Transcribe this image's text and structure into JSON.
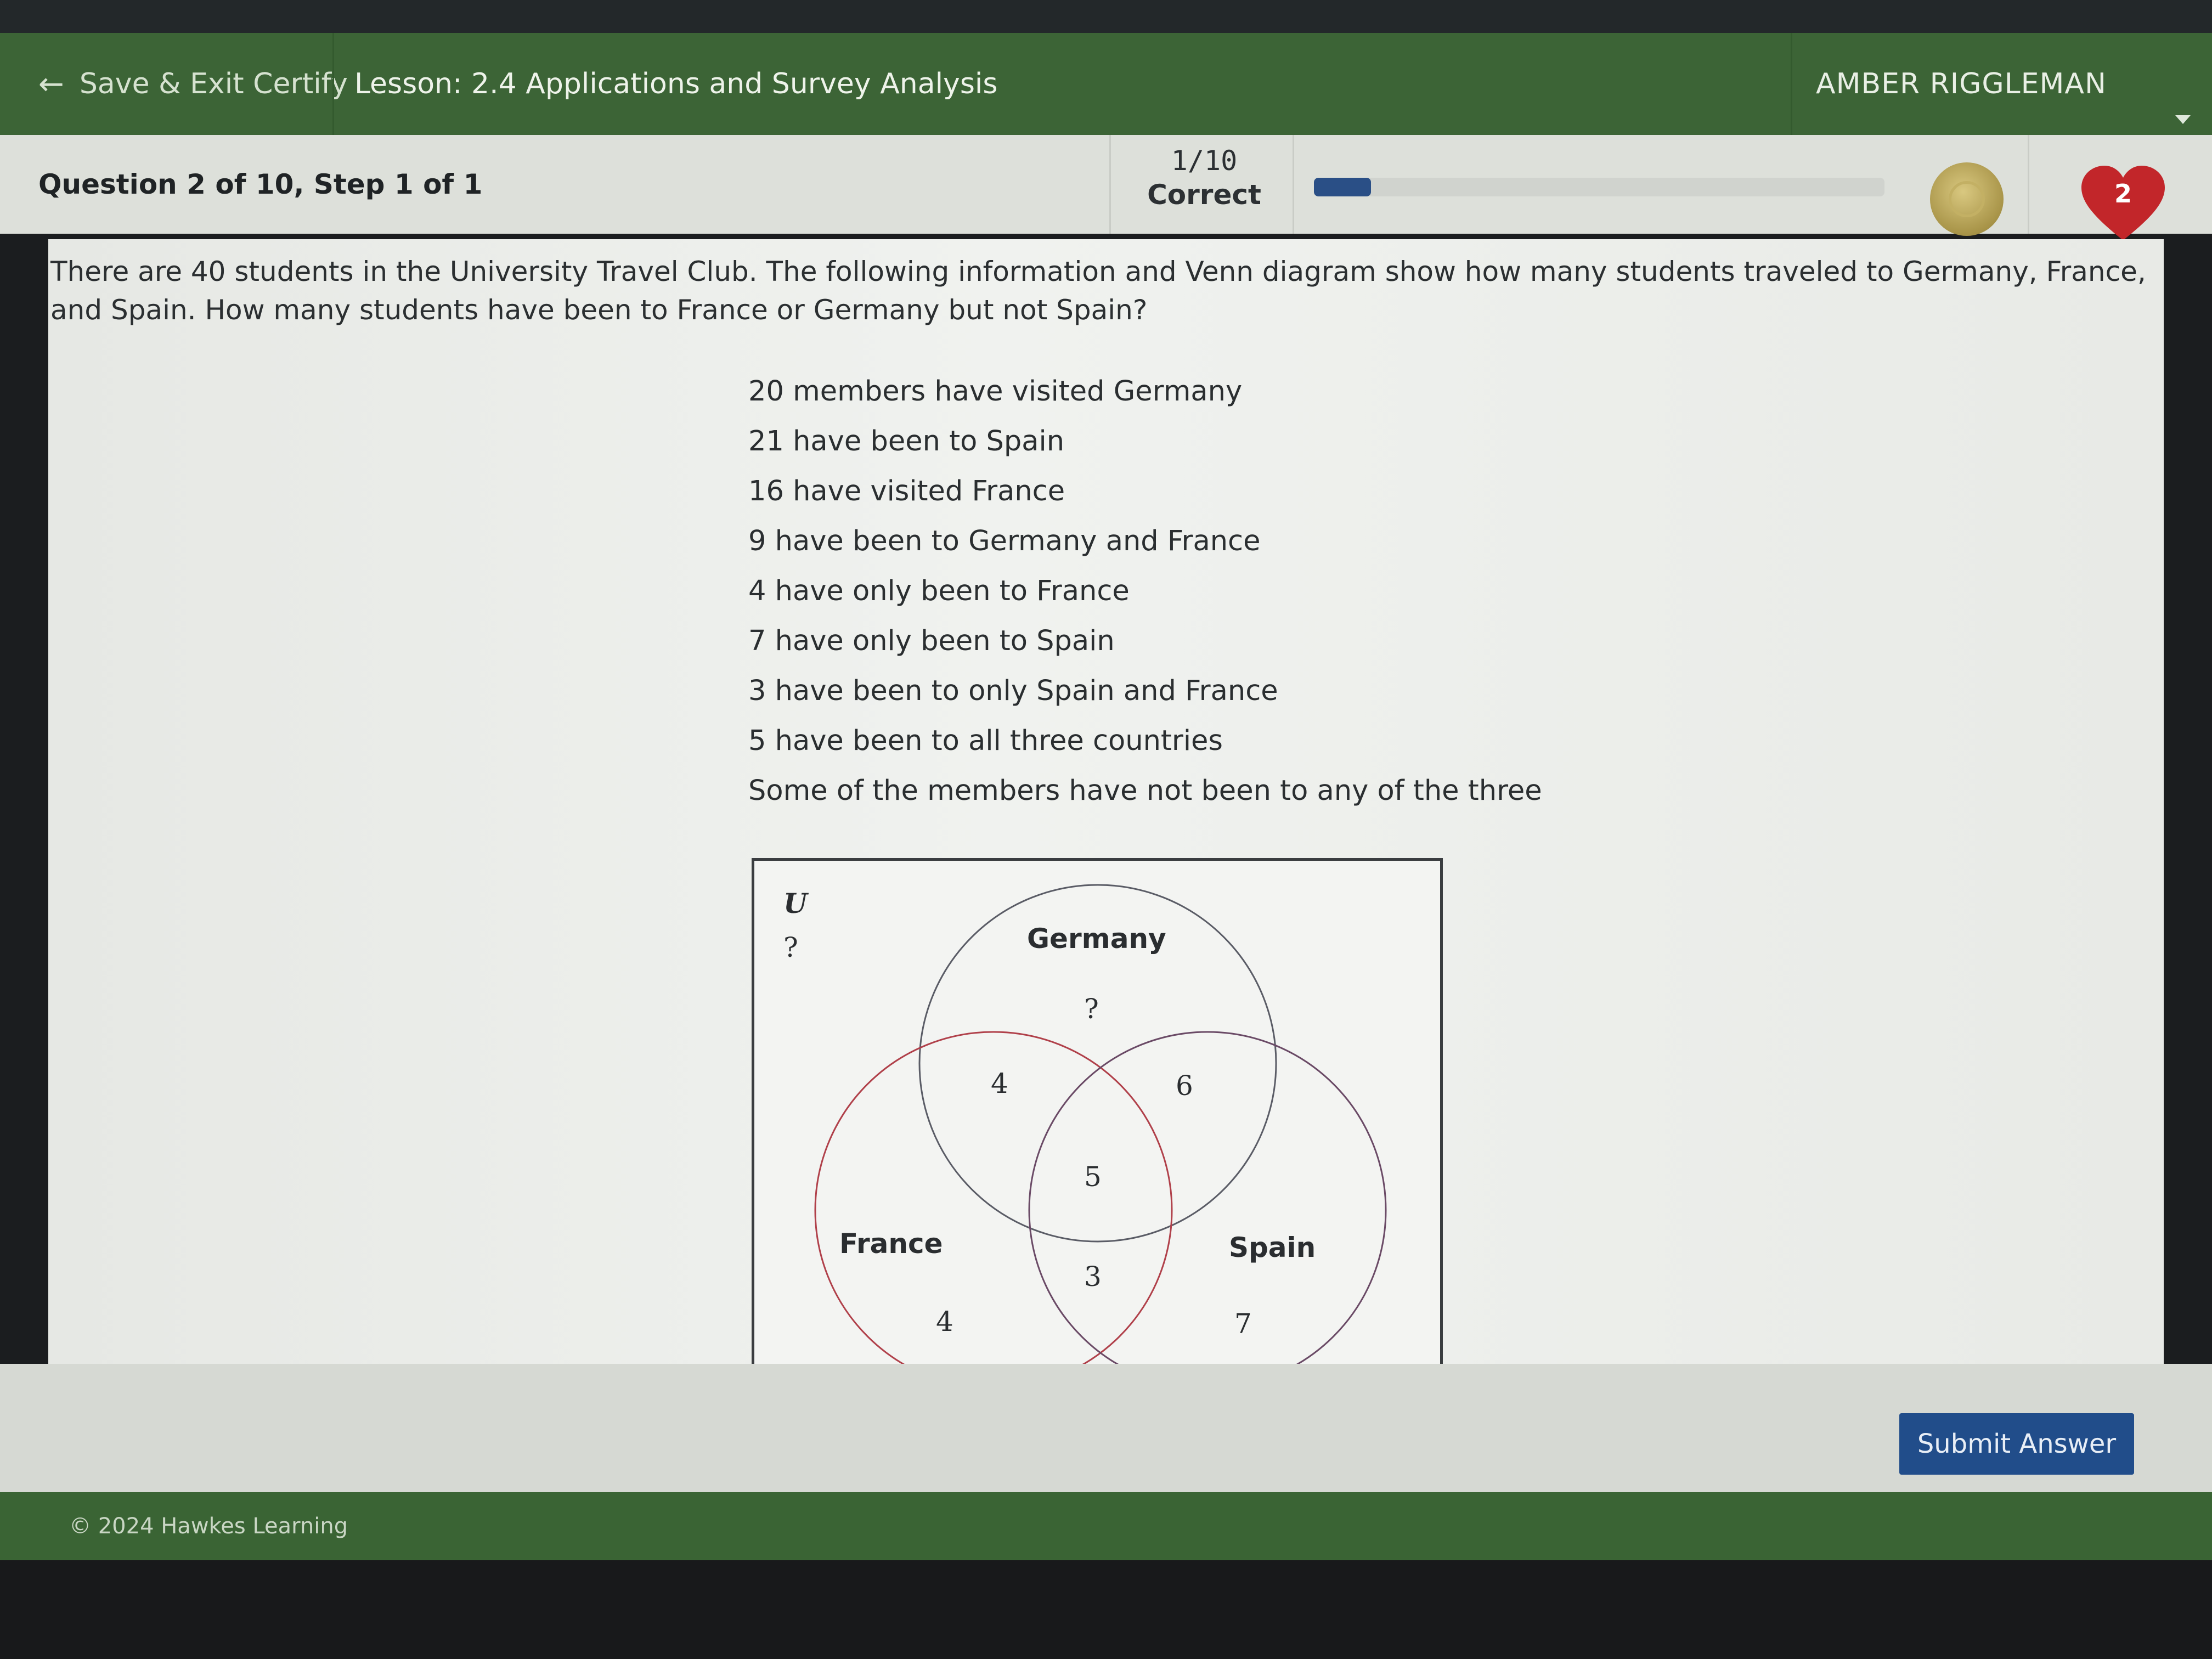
{
  "header": {
    "back_label": "Save & Exit Certify",
    "lesson_title": "Lesson: 2.4 Applications and Survey Analysis",
    "user_name": "AMBER RIGGLEMAN"
  },
  "question_bar": {
    "title": "Question 2 of 10, Step 1 of 1",
    "score_fraction": "1/10",
    "score_label": "Correct",
    "progress_fraction": 0.1,
    "lives": "2"
  },
  "question": {
    "prompt": "There are 40 students in the University Travel Club. The following information and Venn diagram show how many students traveled to Germany, France, and Spain. How many students have been to France or Germany but not Spain?",
    "facts": [
      "20 members have visited Germany",
      "21 have been to Spain",
      "16 have visited France",
      "9 have been to Germany and France",
      "4 have only been to France",
      "7 have only been to Spain",
      "3 have been to only Spain and France",
      "5 have been to all three countries",
      "Some of the members have not been to any of the three"
    ]
  },
  "venn": {
    "universe_label": "U",
    "universe_value": "?",
    "sets": {
      "germany": "Germany",
      "france": "France",
      "spain": "Spain"
    },
    "regions": {
      "germany_only": "?",
      "germany_france": "4",
      "germany_spain": "6",
      "all_three": "5",
      "spain_france": "3",
      "france_only": "4",
      "spain_only": "7"
    },
    "colors": {
      "germany": "#5a5c66",
      "france": "#b0404a",
      "spain": "#6a4a66"
    }
  },
  "actions": {
    "submit_label": "Submit Answer"
  },
  "footer": {
    "copyright": "© 2024 Hawkes Learning"
  }
}
